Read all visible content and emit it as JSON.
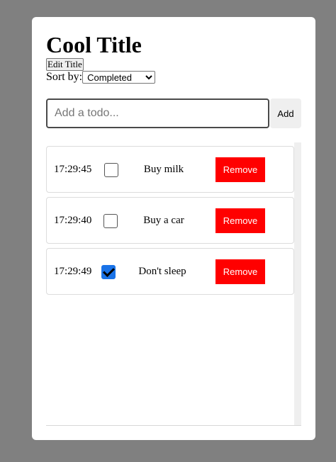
{
  "header": {
    "title": "Cool Title",
    "edit_title_label": "Edit Title",
    "sort_label": "Sort by:",
    "sort_selected": "Completed"
  },
  "input": {
    "placeholder": "Add a todo...",
    "add_label": "Add"
  },
  "colors": {
    "remove_button": "#ff0000",
    "checkbox_checked": "#1a73e8",
    "overlay": "#808080"
  },
  "todos": [
    {
      "time": "17:29:45",
      "text": "Buy milk",
      "completed": false,
      "remove_label": "Remove"
    },
    {
      "time": "17:29:40",
      "text": "Buy a car",
      "completed": false,
      "remove_label": "Remove"
    },
    {
      "time": "17:29:49",
      "text": "Don't sleep",
      "completed": true,
      "remove_label": "Remove"
    }
  ]
}
